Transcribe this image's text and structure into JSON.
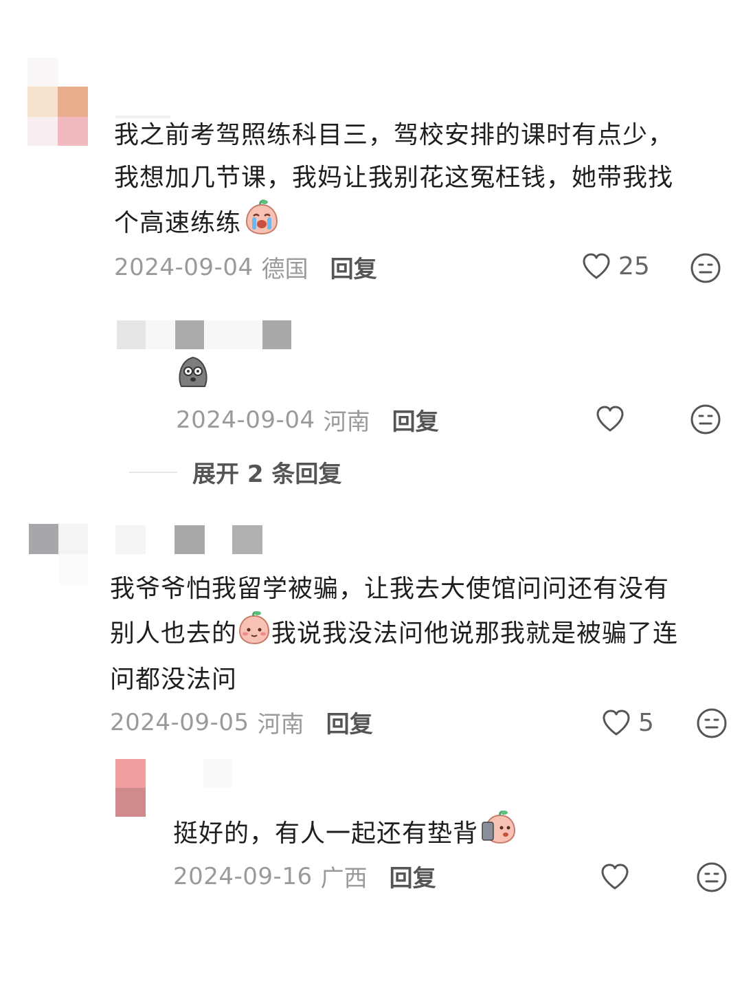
{
  "comments": [
    {
      "text_lines": [
        "我之前考驾照练科目三，驾校安排的课时有点少，",
        "我想加几节课，我妈让我别花这冤枉钱，她带我找",
        "个高速练练"
      ],
      "date": "2024-09-04",
      "location": "德国",
      "reply_label": "回复",
      "likes": "25",
      "reply": {
        "date": "2024-09-04",
        "location": "河南",
        "reply_label": "回复",
        "likes": ""
      },
      "expand_label": "展开 2 条回复"
    },
    {
      "text_lines": [
        "我爷爷怕我留学被骗，让我去大使馆问问还有没有",
        "别人也去的",
        "我说我没法问他说那我就是被骗了连",
        "问都没法问"
      ],
      "date": "2024-09-05",
      "location": "河南",
      "reply_label": "回复",
      "likes": "5",
      "reply": {
        "text": "挺好的，有人一起还有垫背",
        "date": "2024-09-16",
        "location": "广西",
        "reply_label": "回复",
        "likes": ""
      }
    }
  ],
  "icons": {
    "like": "heart-outline-icon",
    "dislike": "meh-face-icon",
    "emoji_crying": "crying-peach-emoji",
    "emoji_shocked": "shocked-ghost-emoji",
    "emoji_smile": "shy-peach-emoji",
    "emoji_phone": "peach-phone-emoji"
  },
  "colors": {
    "meta_gray": "#9a9a9a",
    "text": "#1e1e1e",
    "reply_dark": "#555555"
  }
}
